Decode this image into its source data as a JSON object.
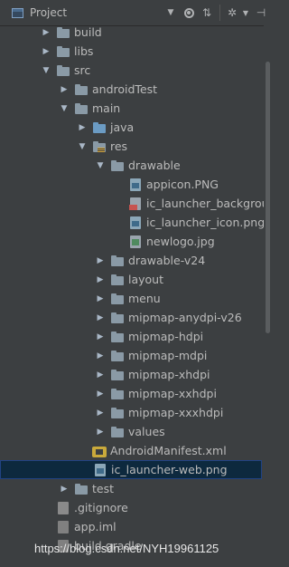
{
  "header": {
    "title": "Project",
    "icons": [
      "dropdown-arrow",
      "target-icon",
      "collapse-all-icon",
      "gear-icon",
      "gear-dropdown",
      "hide-icon"
    ],
    "collapse_glyph": "⇅",
    "gear_glyph": "✲",
    "hide_glyph": "⊣",
    "drop_glyph": "▼"
  },
  "tree": {
    "rows": [
      {
        "label": "build",
        "arrow": "▶",
        "icon": "folder"
      },
      {
        "label": "libs",
        "arrow": "▶",
        "icon": "folder"
      },
      {
        "label": "src",
        "arrow": "▼",
        "icon": "folder"
      },
      {
        "label": "androidTest",
        "arrow": "▶",
        "icon": "folder"
      },
      {
        "label": "main",
        "arrow": "▼",
        "icon": "folder"
      },
      {
        "label": "java",
        "arrow": "▶",
        "icon": "folder-src"
      },
      {
        "label": "res",
        "arrow": "▼",
        "icon": "folder-res"
      },
      {
        "label": "drawable",
        "arrow": "▼",
        "icon": "folder"
      },
      {
        "label": "appicon.PNG",
        "arrow": "",
        "icon": "image-file"
      },
      {
        "label": "ic_launcher_background.xml",
        "arrow": "",
        "icon": "xml-file"
      },
      {
        "label": "ic_launcher_icon.png",
        "arrow": "",
        "icon": "image-file"
      },
      {
        "label": "newlogo.jpg",
        "arrow": "",
        "icon": "jpg-file"
      },
      {
        "label": "drawable-v24",
        "arrow": "▶",
        "icon": "folder"
      },
      {
        "label": "layout",
        "arrow": "▶",
        "icon": "folder"
      },
      {
        "label": "menu",
        "arrow": "▶",
        "icon": "folder"
      },
      {
        "label": "mipmap-anydpi-v26",
        "arrow": "▶",
        "icon": "folder"
      },
      {
        "label": "mipmap-hdpi",
        "arrow": "▶",
        "icon": "folder"
      },
      {
        "label": "mipmap-mdpi",
        "arrow": "▶",
        "icon": "folder"
      },
      {
        "label": "mipmap-xhdpi",
        "arrow": "▶",
        "icon": "folder"
      },
      {
        "label": "mipmap-xxhdpi",
        "arrow": "▶",
        "icon": "folder"
      },
      {
        "label": "mipmap-xxxhdpi",
        "arrow": "▶",
        "icon": "folder"
      },
      {
        "label": "values",
        "arrow": "▶",
        "icon": "folder"
      },
      {
        "label": "AndroidManifest.xml",
        "arrow": "",
        "icon": "manifest-file"
      },
      {
        "label": "ic_launcher-web.png",
        "arrow": "",
        "icon": "image-file",
        "selected": true
      },
      {
        "label": "test",
        "arrow": "▶",
        "icon": "folder"
      },
      {
        "label": ".gitignore",
        "arrow": "",
        "icon": "git-file"
      },
      {
        "label": "app.iml",
        "arrow": "",
        "icon": "iml-file"
      },
      {
        "label": "build.gradle",
        "arrow": "",
        "icon": "gradle-file"
      }
    ]
  },
  "watermark": "https://blog.csdn.net/NYH19961125",
  "colors": {
    "background": "#3c3f41",
    "text": "#bbbbbb",
    "selection": "#0d293e",
    "selection_border": "#214283"
  }
}
